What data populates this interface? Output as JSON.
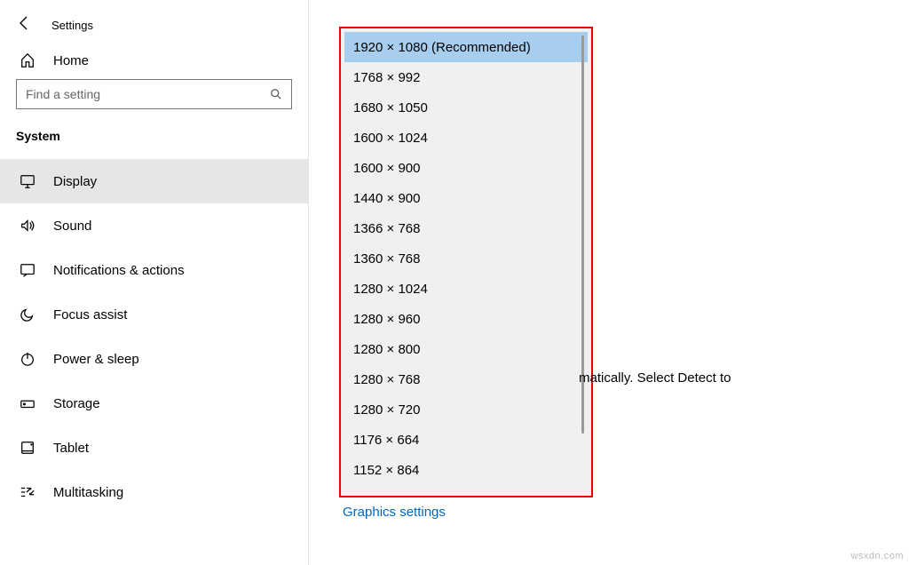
{
  "header": {
    "title": "Settings"
  },
  "home": {
    "label": "Home"
  },
  "search": {
    "placeholder": "Find a setting"
  },
  "category": "System",
  "nav": [
    {
      "label": "Display"
    },
    {
      "label": "Sound"
    },
    {
      "label": "Notifications & actions"
    },
    {
      "label": "Focus assist"
    },
    {
      "label": "Power & sleep"
    },
    {
      "label": "Storage"
    },
    {
      "label": "Tablet"
    },
    {
      "label": "Multitasking"
    }
  ],
  "resolution": {
    "options": [
      "1920 × 1080 (Recommended)",
      "1768 × 992",
      "1680 × 1050",
      "1600 × 1024",
      "1600 × 900",
      "1440 × 900",
      "1366 × 768",
      "1360 × 768",
      "1280 × 1024",
      "1280 × 960",
      "1280 × 800",
      "1280 × 768",
      "1280 × 720",
      "1176 × 664",
      "1152 × 864"
    ]
  },
  "info_fragment": "matically. Select Detect to",
  "links": {
    "graphics": "Graphics settings"
  },
  "watermark": "wsxdn.com"
}
